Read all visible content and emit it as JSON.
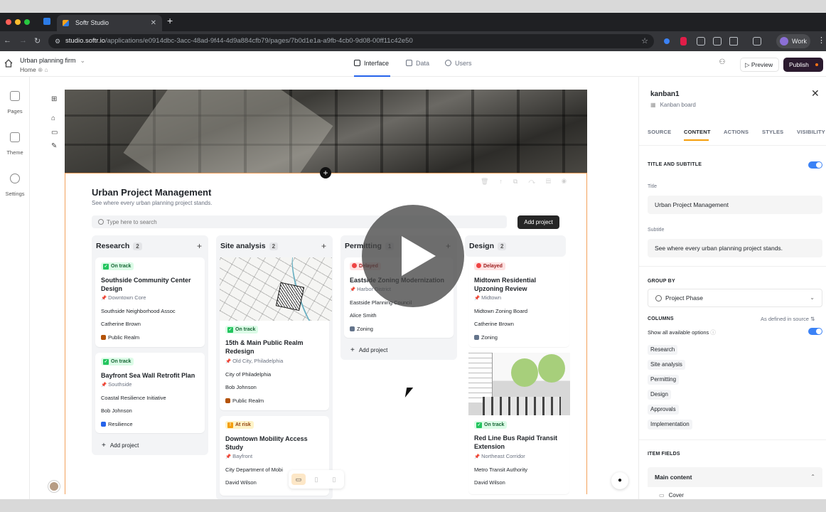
{
  "browser": {
    "tab_title": "Softr Studio",
    "url_host": "studio.softr.io",
    "url_path": "/applications/e0914dbc-3acc-48ad-9f44-4d9a884cfb79/pages/7b0d1e1a-a9fb-4cb0-9d08-00ff11c42e50",
    "profile": "Work"
  },
  "header": {
    "app_name": "Urban planning firm",
    "page_name": "Home",
    "tabs": [
      {
        "label": "Interface",
        "active": true
      },
      {
        "label": "Data",
        "active": false
      },
      {
        "label": "Users",
        "active": false
      }
    ],
    "preview": "Preview",
    "publish": "Publish"
  },
  "left_rail": {
    "items": [
      {
        "label": "Pages",
        "icon": "pages-icon"
      },
      {
        "label": "Theme",
        "icon": "theme-icon"
      },
      {
        "label": "Settings",
        "icon": "settings-icon"
      }
    ]
  },
  "kanban": {
    "title": "Urban Project Management",
    "subtitle": "See where every urban planning project stands.",
    "search_placeholder": "Type here to search",
    "add_button": "Add project",
    "add_in_column": "Add project",
    "columns": [
      {
        "name": "Research",
        "count": "2",
        "cards": [
          {
            "status": "On track",
            "status_kind": "ok",
            "title": "Southside Community Center Design",
            "location": "Downtown Core",
            "org": "Southside Neighborhood Assoc",
            "person": "Catherine Brown",
            "tag": "Public Realm",
            "tag_color": "#b45309"
          },
          {
            "status": "On track",
            "status_kind": "ok",
            "title": "Bayfront Sea Wall Retrofit Plan",
            "location": "Southside",
            "org": "Coastal Resilience Initiative",
            "person": "Bob Johnson",
            "tag": "Resilience",
            "tag_color": "#2563eb"
          }
        ]
      },
      {
        "name": "Site analysis",
        "count": "2",
        "cards": [
          {
            "status": "On track",
            "status_kind": "ok",
            "title": "15th & Main Public Realm Redesign",
            "location": "Old City, Philadelphia",
            "org": "City of Philadelphia",
            "person": "Bob Johnson",
            "tag": "Public Realm",
            "tag_color": "#b45309"
          },
          {
            "status": "At risk",
            "status_kind": "risk",
            "title": "Downtown Mobility Access Study",
            "location": "Bayfront",
            "org": "City Department of Mobi",
            "person": "David Wilson"
          }
        ]
      },
      {
        "name": "Permitting",
        "count": "1",
        "cards": [
          {
            "status": "Delayed",
            "status_kind": "bad",
            "title": "Eastside Zoning Modernization",
            "location": "Harbor District",
            "org": "Eastside Planning Council",
            "person": "Alice Smith",
            "tag": "Zoning",
            "tag_color": "#64748b"
          }
        ]
      },
      {
        "name": "Design",
        "count": "2",
        "cards": [
          {
            "status": "Delayed",
            "status_kind": "bad",
            "title": "Midtown Residential Upzoning Review",
            "location": "Midtown",
            "org": "Midtown Zoning Board",
            "person": "Catherine Brown",
            "tag": "Zoning",
            "tag_color": "#64748b"
          },
          {
            "status": "On track",
            "status_kind": "ok",
            "title": "Red Line Bus Rapid Transit Extension",
            "location": "Northeast Corridor",
            "org": "Metro Transit Authority",
            "person": "David Wilson"
          }
        ]
      }
    ]
  },
  "panel": {
    "block_name": "kanban1",
    "block_type": "Kanban board",
    "tabs": [
      "SOURCE",
      "CONTENT",
      "ACTIONS",
      "STYLES",
      "VISIBILITY"
    ],
    "active_tab": "CONTENT",
    "title_and_subtitle": "TITLE AND SUBTITLE",
    "title_label": "Title",
    "title_value": "Urban Project Management",
    "subtitle_label": "Subtitle",
    "subtitle_value": "See where every urban planning project stands.",
    "group_by": "GROUP BY",
    "group_by_value": "Project Phase",
    "columns_label": "COLUMNS",
    "columns_source": "As defined in source",
    "show_all": "Show all available options",
    "column_options": [
      "Research",
      "Site analysis",
      "Permitting",
      "Design",
      "Approvals",
      "Implementation"
    ],
    "item_fields": "ITEM FIELDS",
    "main_content": "Main content",
    "cover": "Cover"
  },
  "colors": {
    "accent": "#2563eb",
    "selection_outline": "#f3a15b",
    "publish_bg": "#2b1a2e",
    "toggle_on": "#3b82f6"
  }
}
